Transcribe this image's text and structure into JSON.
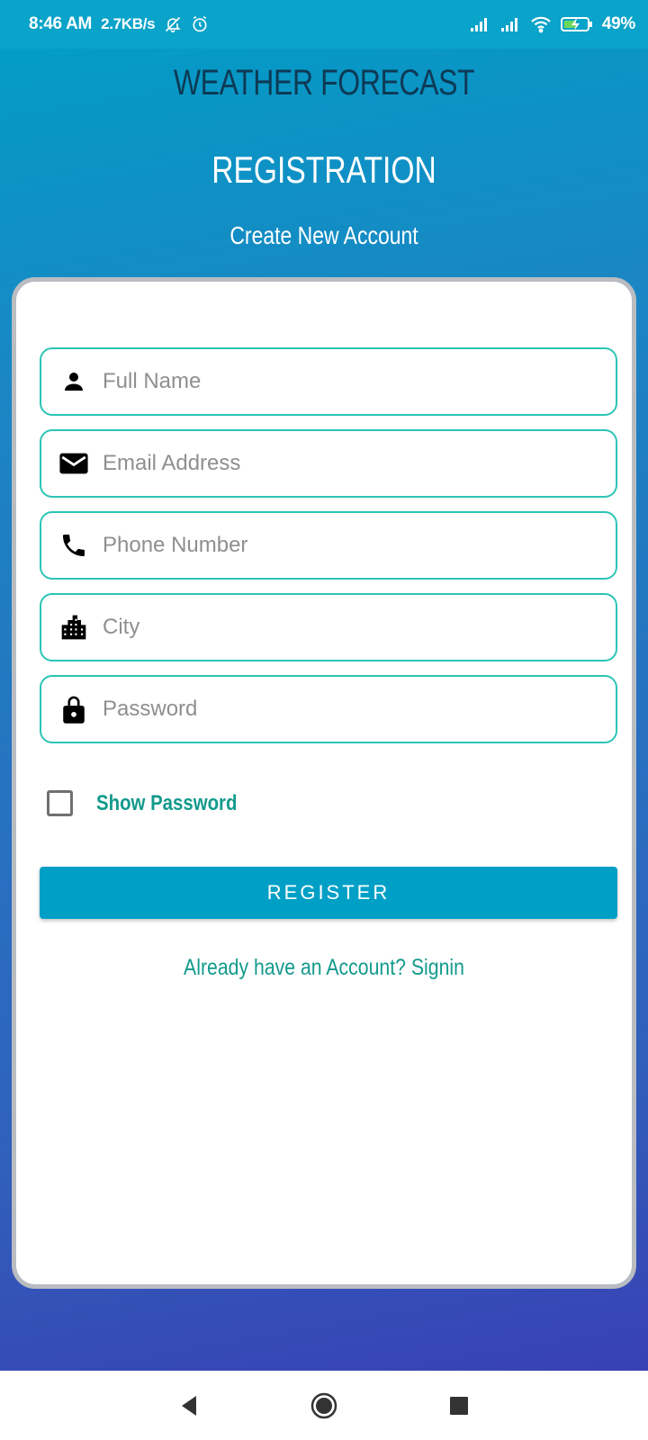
{
  "status_bar": {
    "time": "8:46 AM",
    "speed": "2.7KB/s",
    "battery": "49%",
    "icons": [
      "mute-bell-icon",
      "alarm-icon",
      "signal-icon",
      "signal-icon",
      "wifi-icon",
      "battery-charging-icon"
    ]
  },
  "app_title": "WEATHER FORECAST",
  "page": {
    "title": "REGISTRATION",
    "subtitle": "Create New Account"
  },
  "form": {
    "fields": [
      {
        "placeholder": "Full Name",
        "value": "",
        "icon": "person-icon"
      },
      {
        "placeholder": "Email Address",
        "value": "",
        "icon": "email-icon"
      },
      {
        "placeholder": "Phone Number",
        "value": "",
        "icon": "phone-icon"
      },
      {
        "placeholder": "City",
        "value": "",
        "icon": "city-icon"
      },
      {
        "placeholder": "Password",
        "value": "",
        "icon": "lock-icon"
      }
    ],
    "show_password_label": "Show Password",
    "show_password_checked": false,
    "register_label": "REGISTER",
    "signin_text": "Already have an Account? Signin"
  },
  "nav": {
    "icons": [
      "back-icon",
      "home-icon",
      "recents-icon"
    ]
  },
  "colors": {
    "accent": "#00a0c6",
    "field_border": "#2cc5b6",
    "link": "#139a8c",
    "title_dark": "#0d3a55"
  }
}
